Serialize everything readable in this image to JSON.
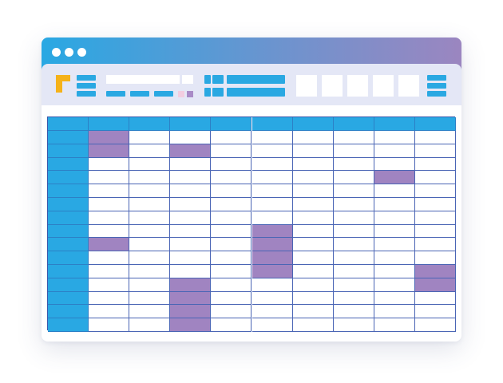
{
  "window": {
    "controls": [
      "window-dot-1",
      "window-dot-2",
      "window-dot-3"
    ]
  },
  "toolbar": {
    "logo_color": "#f5b21a",
    "accent_color": "#29a8e3",
    "gradient": [
      "#29a8e3",
      "#9b86c0"
    ]
  },
  "grid": {
    "rows": 15,
    "cols": 10,
    "header_color": "#29a8e3",
    "block_color": "#a084c1",
    "blocks": [
      {
        "col": 1,
        "row": 0,
        "span": 2
      },
      {
        "col": 3,
        "row": 1,
        "span": 1
      },
      {
        "col": 8,
        "row": 3,
        "span": 1
      },
      {
        "col": 1,
        "row": 8,
        "span": 1
      },
      {
        "col": 5,
        "row": 7,
        "span": 4
      },
      {
        "col": 9,
        "row": 10,
        "span": 2
      },
      {
        "col": 3,
        "row": 11,
        "span": 4
      }
    ]
  }
}
